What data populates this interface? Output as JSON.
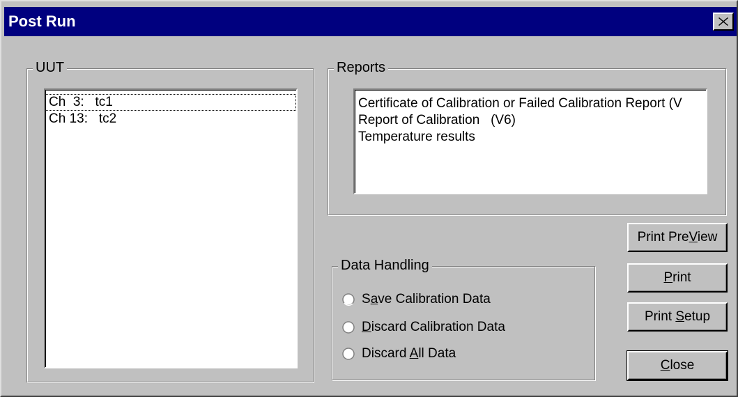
{
  "window": {
    "title": "Post Run"
  },
  "uut": {
    "label": "UUT",
    "items": [
      {
        "text": "Ch  3:   tc1"
      },
      {
        "text": "Ch 13:   tc2"
      }
    ]
  },
  "reports": {
    "label": "Reports",
    "items": [
      {
        "text": "Certificate of Calibration or Failed Calibration Report (V"
      },
      {
        "text": "Report of Calibration   (V6)"
      },
      {
        "text": "Temperature results"
      }
    ]
  },
  "data_handling": {
    "label": "Data Handling",
    "options": [
      {
        "pre": "S",
        "mnemonic": "a",
        "post": "ve Calibration Data"
      },
      {
        "pre": "",
        "mnemonic": "D",
        "post": "iscard Calibration Data"
      },
      {
        "pre": "Discard ",
        "mnemonic": "A",
        "post": "ll Data"
      }
    ]
  },
  "buttons": {
    "print_preview": {
      "pre": "Print Pre",
      "mnemonic": "V",
      "post": "iew"
    },
    "print": {
      "pre": "",
      "mnemonic": "P",
      "post": "rint"
    },
    "print_setup": {
      "pre": "Print ",
      "mnemonic": "S",
      "post": "etup"
    },
    "close": {
      "pre": "",
      "mnemonic": "C",
      "post": "lose"
    }
  },
  "icons": {
    "close": "close-x-icon",
    "radio": "radio-button-icon"
  }
}
